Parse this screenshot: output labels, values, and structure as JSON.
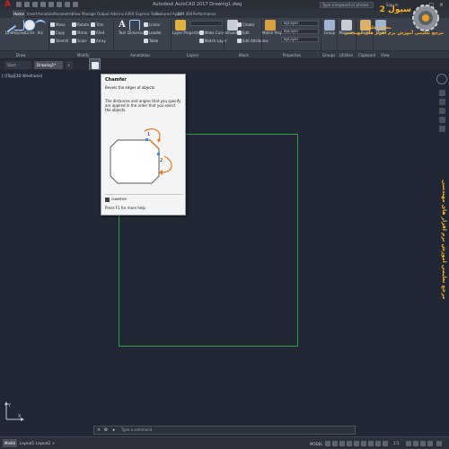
{
  "app": {
    "title": "Autodesk AutoCAD 2017 Drawing1.dwg",
    "search_placeholder": "Type a keyword or phrase",
    "signin": "Sign In",
    "brand_color": "#d02020"
  },
  "ribbon_tabs": [
    "Home",
    "Insert",
    "Annotate",
    "Parametric",
    "View",
    "Manage",
    "Output",
    "Add-ins",
    "A360",
    "Express Tools",
    "Featured Apps",
    "BIM 360",
    "Performance"
  ],
  "draw_panel": {
    "title": "Draw",
    "big_tools": [
      "Line",
      "Polyline",
      "Circle",
      "Arc"
    ]
  },
  "modify_panel": {
    "title": "Modify",
    "small_tools": [
      "Move",
      "Rotate",
      "Trim",
      "Copy",
      "Mirror",
      "Fillet",
      "Stretch",
      "Scale",
      "Array",
      "Chamfer"
    ]
  },
  "annotation_panel": {
    "title": "Annotation",
    "big_tools": [
      "Text",
      "Dimension"
    ],
    "small_tools": [
      "Linear",
      "Leader",
      "Table"
    ]
  },
  "layers_panel": {
    "title": "Layers",
    "big_tools": [
      "Layer Properties"
    ],
    "small_tools": [
      "Make Current",
      "Match Layer"
    ]
  },
  "block_panel": {
    "title": "Block",
    "big_tools": [
      "Insert"
    ],
    "small_tools": [
      "Create",
      "Edit",
      "Edit Attributes"
    ]
  },
  "properties_panel": {
    "title": "Properties",
    "big_tools": [
      "Match Properties"
    ],
    "combo_values": [
      "ByLayer",
      "ByLayer",
      "ByLayer"
    ]
  },
  "groups_panel": {
    "title": "Groups",
    "big_tools": [
      "Group"
    ]
  },
  "utilities_panel": {
    "title": "Utilities",
    "big_tools": [
      "Measure"
    ]
  },
  "clipboard_panel": {
    "title": "Clipboard",
    "big_tools": [
      "Paste"
    ]
  },
  "view_panel": {
    "title": "View",
    "big_tools": [
      "Base"
    ]
  },
  "file_tabs": [
    "Start",
    "Drawing1*"
  ],
  "viewport_label": "[-][Top][2D Wireframe]",
  "tooltip": {
    "title": "Chamfer",
    "subtitle": "Bevels the edges of objects",
    "description": "The distances and angles that you specify are applied in the order that you select the objects.",
    "figure_labels": [
      "1",
      "2"
    ],
    "command": "CHAMFER",
    "help": "Press F1 for more help"
  },
  "command_line": {
    "prompt": "Type a command"
  },
  "status_bar": {
    "layout_tabs": [
      "Model",
      "Layout1",
      "Layout2"
    ],
    "model_label": "MODEL",
    "scale": "1:1"
  },
  "logo": {
    "title_text": "سيول 2",
    "subtitle_top": "مجمع تعليمي",
    "subtitle": "مرجع تعليمي آموزش نرم افزار های مهندسی",
    "side_watermark": "مرجع تعليمي آموزش نرم افزار های مهندسی",
    "accent": "#ffb21e"
  },
  "colors": {
    "canvas_bg": "#212734",
    "ribbon_bg": "#3b424d",
    "rectangle_stroke": "#2fa043",
    "tooltip_arrow": "#e8741a"
  }
}
